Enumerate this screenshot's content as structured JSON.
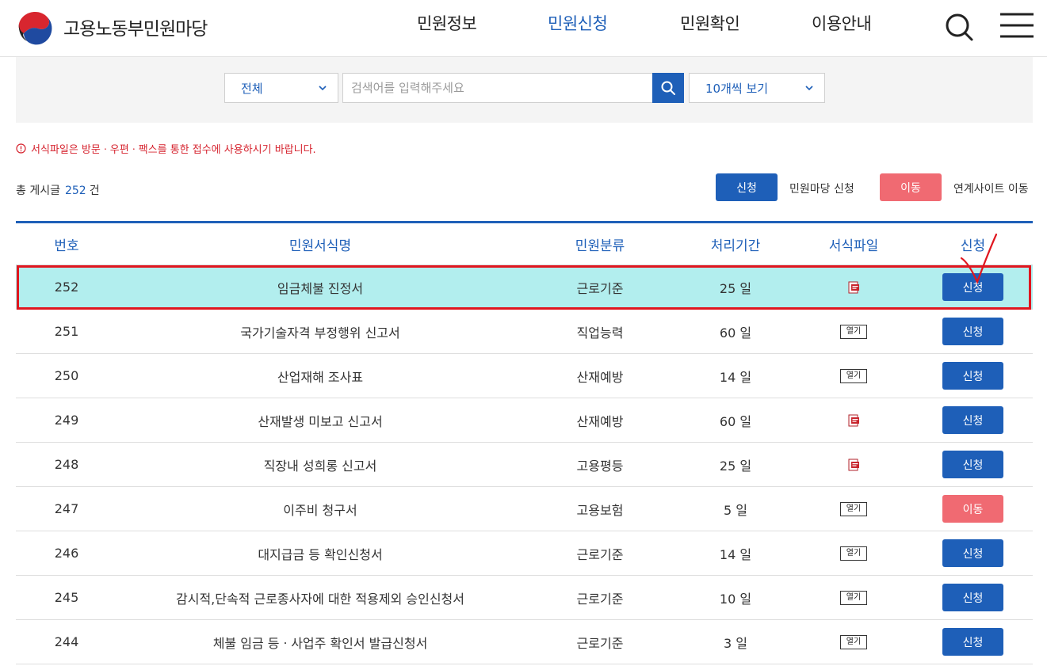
{
  "brand": {
    "name": "고용노동부민원마당"
  },
  "nav": {
    "items": [
      "민원정보",
      "민원신청",
      "민원확인",
      "이용안내"
    ],
    "active": "민원신청"
  },
  "search": {
    "category": "전체",
    "placeholder": "검색어를 입력해주세요",
    "value": "",
    "page_size": "10개씩 보기"
  },
  "notice": "서식파일은 방문ㆍ우편ㆍ팩스를 통한 접수에 사용하시기 바랍니다.",
  "summary": {
    "label": "총 게시글",
    "count": "252",
    "unit": "건"
  },
  "legend": {
    "apply_label": "신청",
    "apply_desc": "민원마당 신청",
    "move_label": "이동",
    "move_desc": "연계사이트 이동"
  },
  "table": {
    "headers": [
      "번호",
      "민원서식명",
      "민원분류",
      "처리기간",
      "서식파일",
      "신청"
    ],
    "rows": [
      {
        "no": "252",
        "name": "임금체불 진정서",
        "category": "근로기준",
        "days": "25 일",
        "file": "pdf-icon",
        "action": "신청",
        "action_type": "apply",
        "highlighted": true
      },
      {
        "no": "251",
        "name": "국가기술자격 부정행위 신고서",
        "category": "직업능력",
        "days": "60 일",
        "file": "열기",
        "action": "신청",
        "action_type": "apply"
      },
      {
        "no": "250",
        "name": "산업재해 조사표",
        "category": "산재예방",
        "days": "14 일",
        "file": "열기",
        "action": "신청",
        "action_type": "apply"
      },
      {
        "no": "249",
        "name": "산재발생 미보고 신고서",
        "category": "산재예방",
        "days": "60 일",
        "file": "pdf-icon",
        "action": "신청",
        "action_type": "apply"
      },
      {
        "no": "248",
        "name": "직장내 성희롱 신고서",
        "category": "고용평등",
        "days": "25 일",
        "file": "pdf-icon",
        "action": "신청",
        "action_type": "apply"
      },
      {
        "no": "247",
        "name": "이주비 청구서",
        "category": "고용보험",
        "days": "5 일",
        "file": "열기",
        "action": "이동",
        "action_type": "move"
      },
      {
        "no": "246",
        "name": "대지급금 등 확인신청서",
        "category": "근로기준",
        "days": "14 일",
        "file": "열기",
        "action": "신청",
        "action_type": "apply"
      },
      {
        "no": "245",
        "name": "감시적,단속적 근로종사자에 대한 적용제외 승인신청서",
        "category": "근로기준",
        "days": "10 일",
        "file": "열기",
        "action": "신청",
        "action_type": "apply"
      },
      {
        "no": "244",
        "name": "체불 임금 등ㆍ사업주 확인서 발급신청서",
        "category": "근로기준",
        "days": "3 일",
        "file": "열기",
        "action": "신청",
        "action_type": "apply"
      }
    ]
  },
  "colors": {
    "primary": "#1e5fb8",
    "move": "#f06a72",
    "highlight_row": "#b2eeee",
    "highlight_border": "#e0161f",
    "notice": "#d6242f"
  }
}
